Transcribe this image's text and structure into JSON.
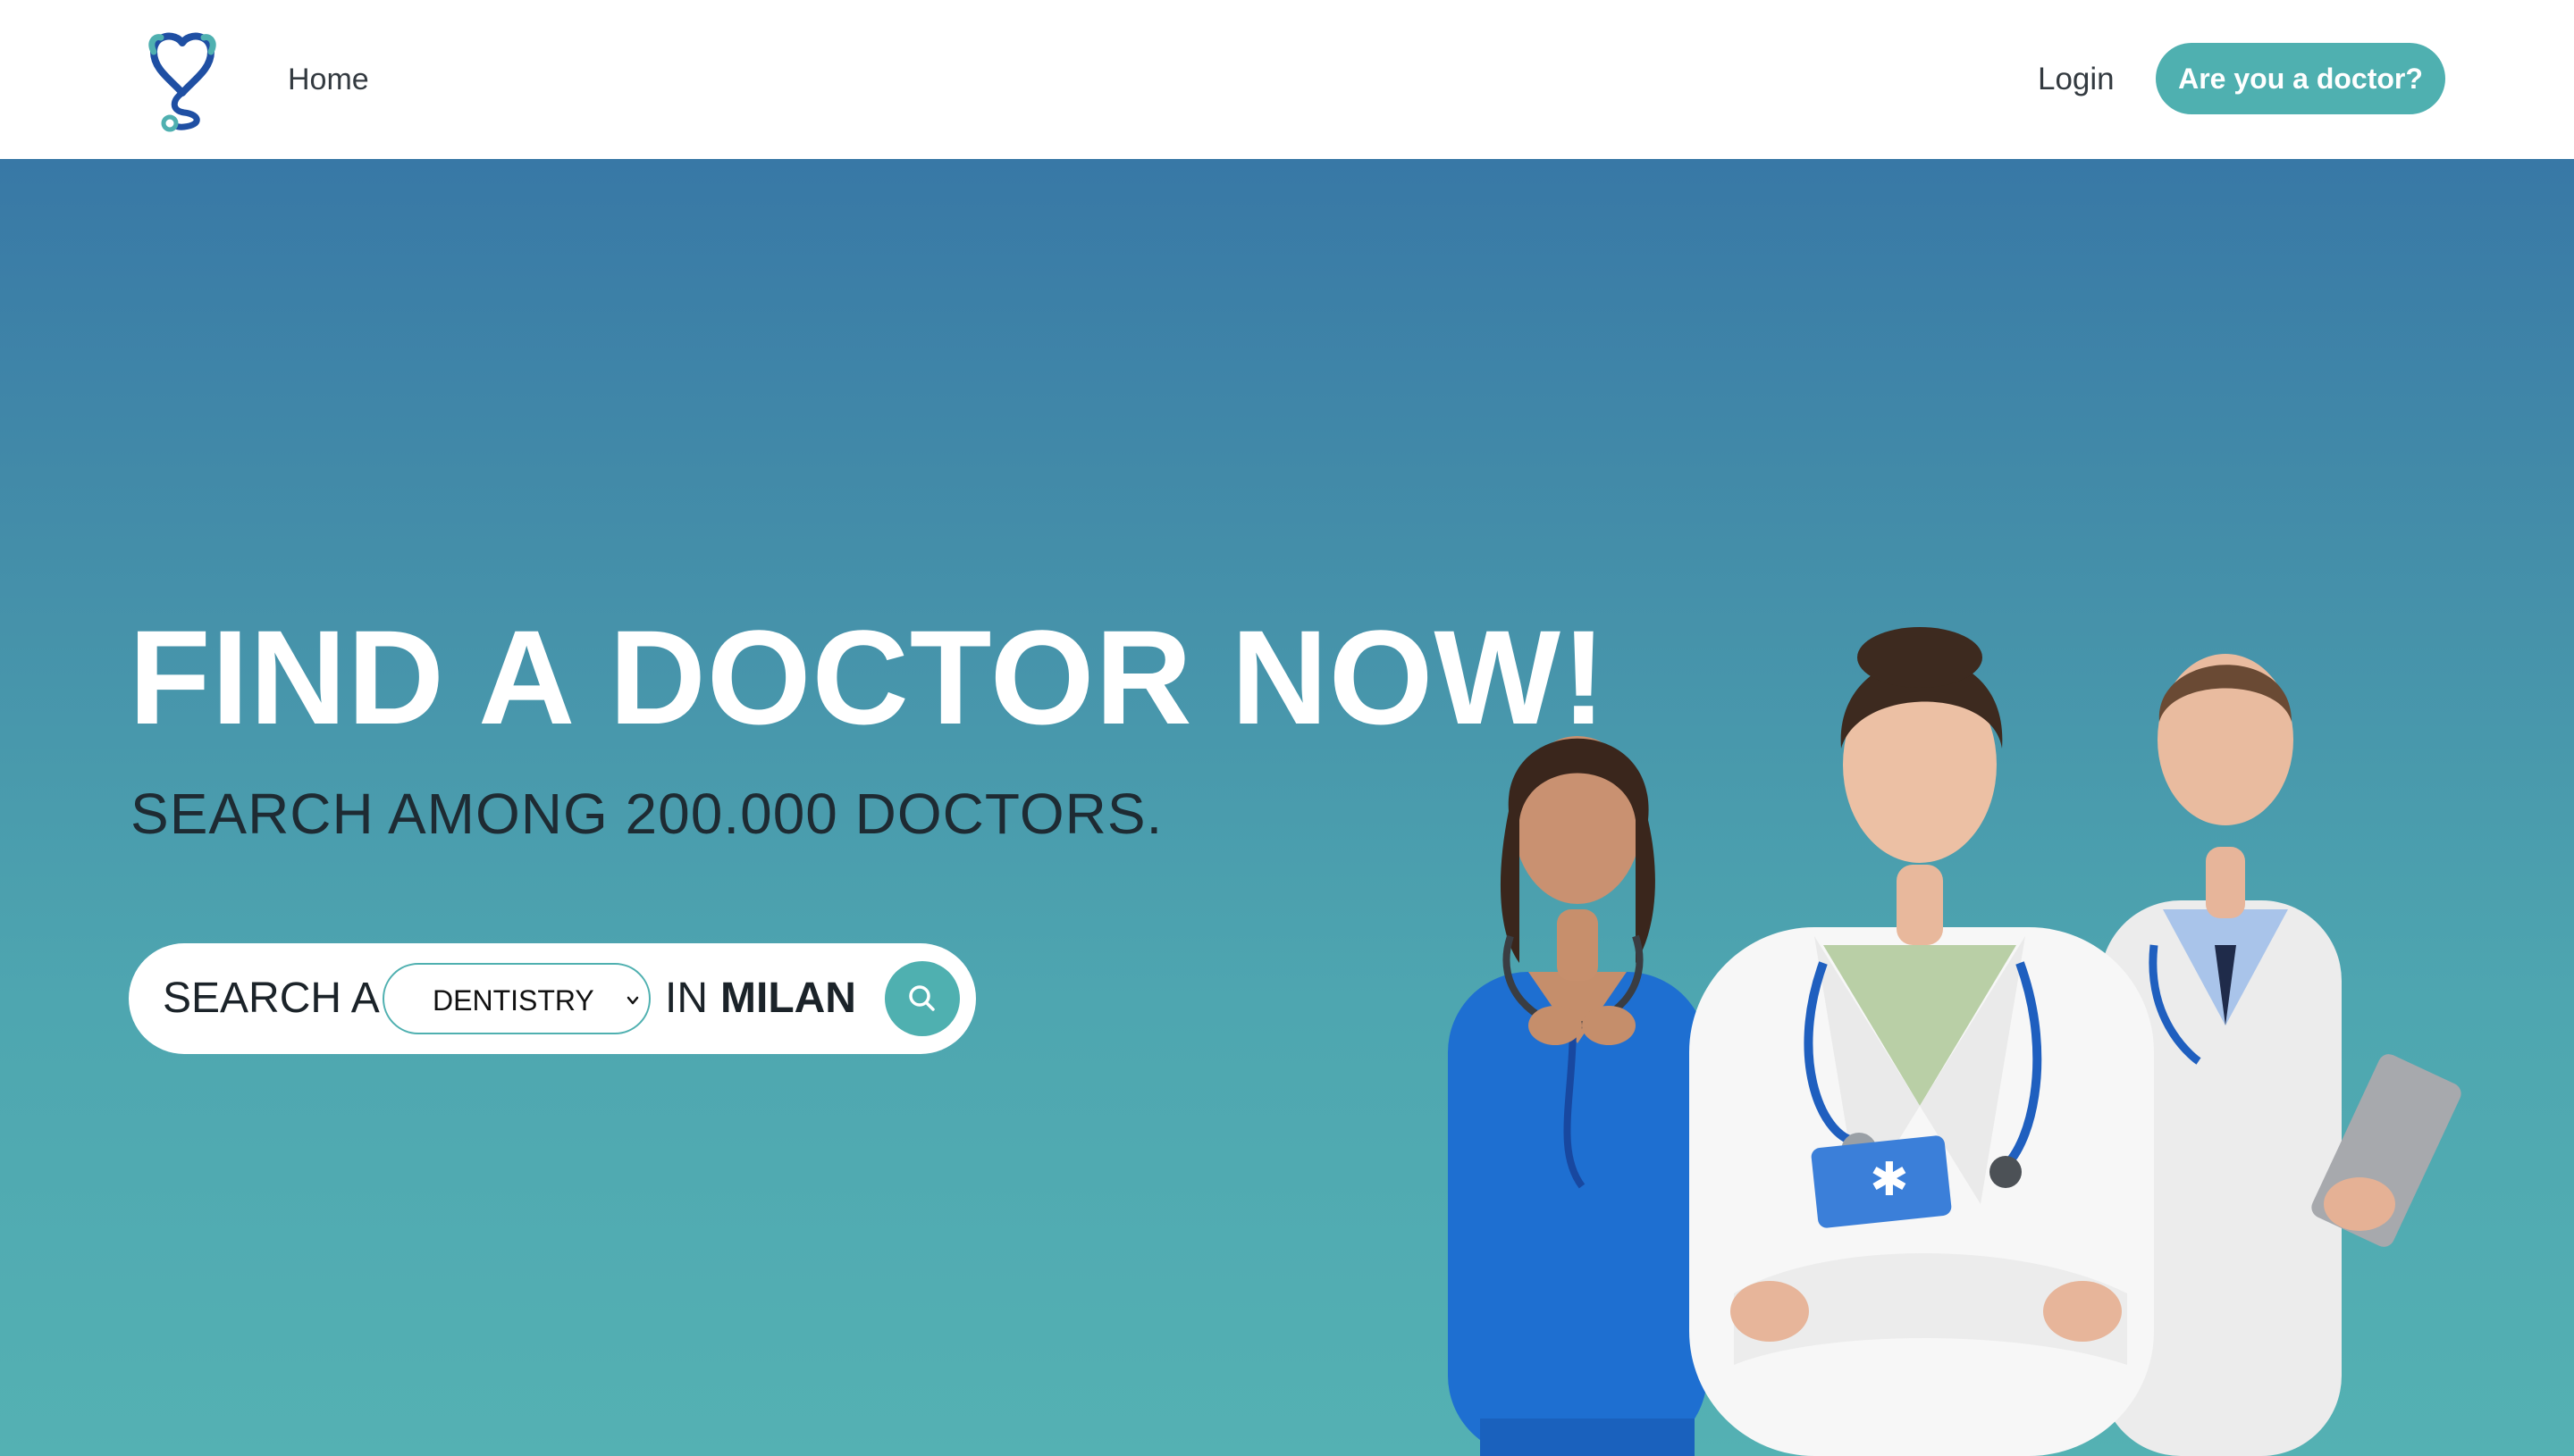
{
  "nav": {
    "logo_icon": "stethoscope-heart-icon",
    "home_label": "Home",
    "login_label": "Login",
    "cta_label": "Are you a doctor?"
  },
  "hero": {
    "title": "FIND A DOCTOR NOW!",
    "subtitle": "SEARCH AMONG 200.000 DOCTORS.",
    "search": {
      "prefix": "SEARCH A",
      "specialty_selected": "DENTISTRY",
      "in_label": "IN",
      "city": "MILAN",
      "button_icon": "search-icon"
    },
    "image_alt": "three-doctors-photo"
  },
  "colors": {
    "accent": "#4fb0b0",
    "gradient_top": "#3878a6",
    "gradient_bottom": "#54b1b3",
    "logo_blue": "#1f4fa3",
    "logo_teal": "#4fb0b0"
  }
}
